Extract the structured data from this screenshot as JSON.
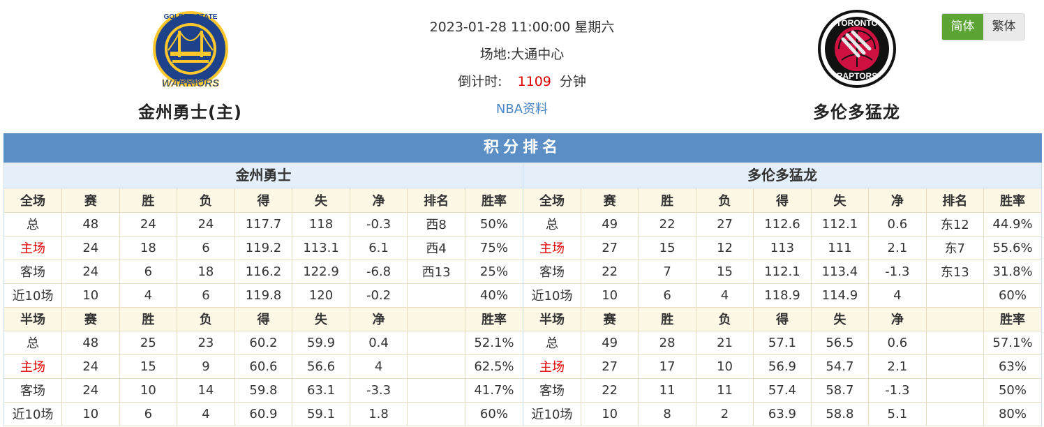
{
  "home_team": {
    "name": "金州勇士(主)",
    "logo_icon": "golden-state-warriors-logo",
    "logo_text_top": "GOLDEN STATE",
    "logo_text_bottom": "WARRIORS"
  },
  "away_team": {
    "name": "多伦多猛龙",
    "logo_icon": "toronto-raptors-logo",
    "logo_text_top": "TORONTO",
    "logo_text_bottom": "RAPTORS"
  },
  "match": {
    "datetime": "2023-01-28 11:00:00 星期六",
    "venue_label": "场地:",
    "venue": "大通中心",
    "countdown_label": "倒计时:",
    "countdown_value": "1109",
    "countdown_unit": "分钟",
    "nba_link": "NBA资料"
  },
  "lang": {
    "simplified": "简体",
    "traditional": "繁体"
  },
  "colors": {
    "accent_blue": "#5b8ec4",
    "active_green": "#5ca534",
    "highlight_red": "#e00000"
  },
  "standings": {
    "title": "积分排名",
    "panels": [
      {
        "team": "金州勇士",
        "full_header": [
          "全场",
          "赛",
          "胜",
          "负",
          "得",
          "失",
          "净",
          "排名",
          "胜率"
        ],
        "full_rows": [
          [
            "总",
            "48",
            "24",
            "24",
            "117.7",
            "118",
            "-0.3",
            "西8",
            "50%"
          ],
          [
            "主场",
            "24",
            "18",
            "6",
            "119.2",
            "113.1",
            "6.1",
            "西4",
            "75%"
          ],
          [
            "客场",
            "24",
            "6",
            "18",
            "116.2",
            "122.9",
            "-6.8",
            "西13",
            "25%"
          ],
          [
            "近10场",
            "10",
            "4",
            "6",
            "119.8",
            "120",
            "-0.2",
            "",
            "40%"
          ]
        ],
        "half_header": [
          "半场",
          "赛",
          "胜",
          "负",
          "得",
          "失",
          "净",
          "",
          "胜率"
        ],
        "half_rows": [
          [
            "总",
            "48",
            "25",
            "23",
            "60.2",
            "59.9",
            "0.4",
            "",
            "52.1%"
          ],
          [
            "主场",
            "24",
            "15",
            "9",
            "60.6",
            "56.6",
            "4",
            "",
            "62.5%"
          ],
          [
            "客场",
            "24",
            "10",
            "14",
            "59.8",
            "63.1",
            "-3.3",
            "",
            "41.7%"
          ],
          [
            "近10场",
            "10",
            "6",
            "4",
            "60.9",
            "59.1",
            "1.8",
            "",
            "60%"
          ]
        ]
      },
      {
        "team": "多伦多猛龙",
        "full_header": [
          "全场",
          "赛",
          "胜",
          "负",
          "得",
          "失",
          "净",
          "排名",
          "胜率"
        ],
        "full_rows": [
          [
            "总",
            "49",
            "22",
            "27",
            "112.6",
            "112.1",
            "0.6",
            "东12",
            "44.9%"
          ],
          [
            "主场",
            "27",
            "15",
            "12",
            "113",
            "111",
            "2.1",
            "东7",
            "55.6%"
          ],
          [
            "客场",
            "22",
            "7",
            "15",
            "112.1",
            "113.4",
            "-1.3",
            "东13",
            "31.8%"
          ],
          [
            "近10场",
            "10",
            "6",
            "4",
            "118.9",
            "114.9",
            "4",
            "",
            "60%"
          ]
        ],
        "half_header": [
          "半场",
          "赛",
          "胜",
          "负",
          "得",
          "失",
          "净",
          "",
          "胜率"
        ],
        "half_rows": [
          [
            "总",
            "49",
            "28",
            "21",
            "57.1",
            "56.5",
            "0.6",
            "",
            "57.1%"
          ],
          [
            "主场",
            "27",
            "17",
            "10",
            "56.9",
            "54.7",
            "2.1",
            "",
            "63%"
          ],
          [
            "客场",
            "22",
            "11",
            "11",
            "57.4",
            "58.7",
            "-1.3",
            "",
            "50%"
          ],
          [
            "近10场",
            "10",
            "8",
            "2",
            "63.9",
            "58.8",
            "5.1",
            "",
            "80%"
          ]
        ]
      }
    ]
  }
}
